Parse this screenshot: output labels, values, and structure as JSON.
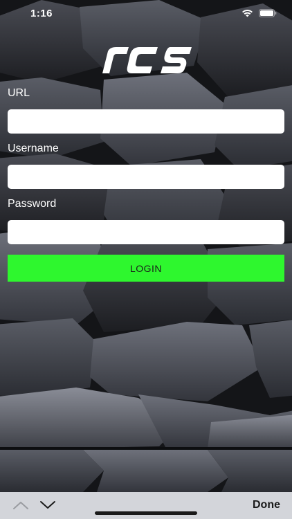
{
  "status_bar": {
    "time": "1:16",
    "wifi_icon": "wifi-icon",
    "battery_icon": "battery-icon"
  },
  "logo": {
    "text": "rcs",
    "icon": "rcs-logo"
  },
  "form": {
    "url_label": "URL",
    "url_value": "",
    "username_label": "Username",
    "username_value": "",
    "password_label": "Password",
    "password_value": "",
    "login_label": "LOGIN"
  },
  "keyboard_toolbar": {
    "prev_icon": "chevron-up-icon",
    "next_icon": "chevron-down-icon",
    "done_label": "Done"
  },
  "colors": {
    "login_button": "#2ef72e",
    "input_background": "#ffffff",
    "toolbar_background": "#d3d5da"
  }
}
